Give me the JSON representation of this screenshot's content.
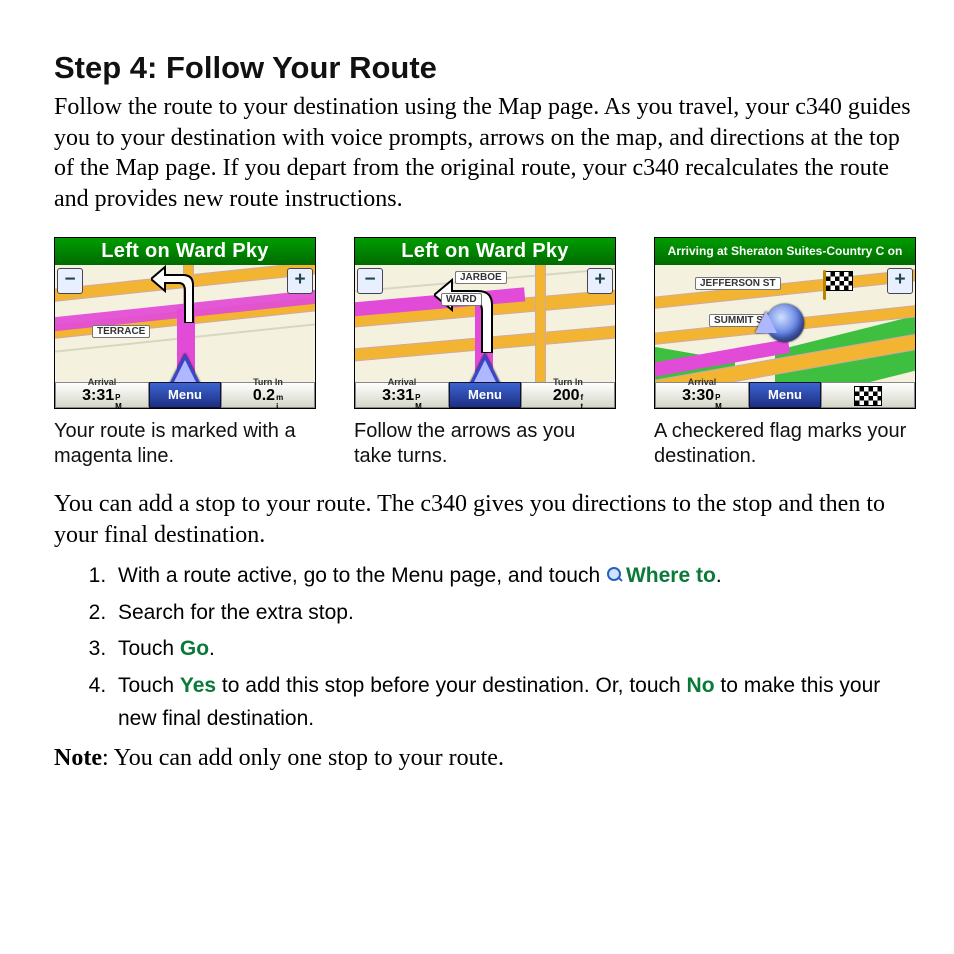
{
  "title": "Step 4: Follow Your Route",
  "intro": "Follow the route to your destination using the Map page. As you travel, your c340 guides you to your destination with voice prompts, arrows on the map, and directions at the top of the Map page. If you depart from the original route, your c340 recalculates the route and provides new route instructions.",
  "shots": [
    {
      "titlebar": "Left on Ward Pky",
      "zoom_out": "−",
      "zoom_in": "+",
      "streets": [
        "TERRACE"
      ],
      "arrival_label": "Arrival",
      "arrival_time": "3:31",
      "arrival_suffix_top": "P",
      "arrival_suffix_bot": "M",
      "menu": "Menu",
      "turn_label": "Turn In",
      "turn_value": "0.2",
      "turn_unit_top": "m",
      "turn_unit_bot": "i",
      "caption": "Your route is marked with a magenta line."
    },
    {
      "titlebar": "Left on Ward Pky",
      "zoom_out": "−",
      "zoom_in": "+",
      "streets": [
        "JARBOE",
        "WARD"
      ],
      "arrival_label": "Arrival",
      "arrival_time": "3:31",
      "arrival_suffix_top": "P",
      "arrival_suffix_bot": "M",
      "menu": "Menu",
      "turn_label": "Turn In",
      "turn_value": "200",
      "turn_unit_top": "f",
      "turn_unit_bot": "t",
      "caption": "Follow the arrows as you take turns."
    },
    {
      "titlebar": "Arriving at Sheraton Suites-Country C on",
      "zoom_in": "+",
      "streets": [
        "JEFFERSON ST",
        "SUMMIT ST"
      ],
      "arrival_label": "Arrival",
      "arrival_time": "3:30",
      "arrival_suffix_top": "P",
      "arrival_suffix_bot": "M",
      "menu": "Menu",
      "caption": "A checkered flag marks your destination."
    }
  ],
  "mid": "You can add a stop to your route. The c340 gives you directions to the stop and then to your final destination.",
  "steps": {
    "s1a": "With a route active, go to the Menu page, and touch ",
    "s1b": "Where to",
    "s1c": ".",
    "s2": "Search for the extra stop.",
    "s3a": "Touch ",
    "s3b": "Go",
    "s3c": ".",
    "s4a": "Touch ",
    "s4b": "Yes",
    "s4c": " to add this stop before your destination. Or, touch ",
    "s4d": "No",
    "s4e": " to make this your new final destination."
  },
  "note_label": "Note",
  "note_text": ": You can add only one stop to your route."
}
